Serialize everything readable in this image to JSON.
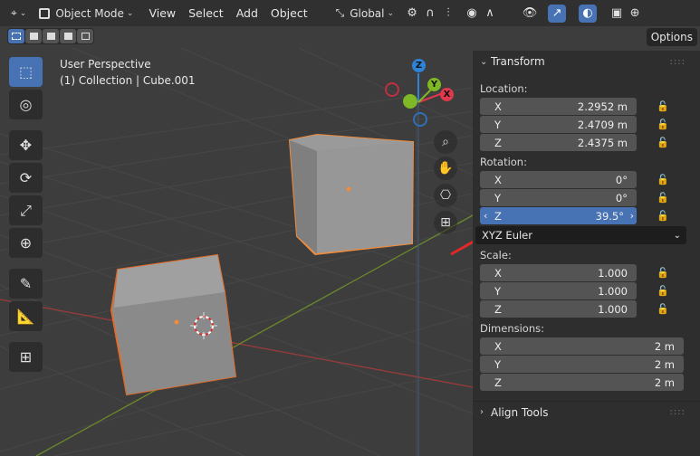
{
  "header": {
    "mode_label": "Object Mode",
    "menus": [
      "View",
      "Select",
      "Add",
      "Object"
    ],
    "orientation_label": "Global"
  },
  "options_label": "Options",
  "overlay": {
    "line1": "User Perspective",
    "line2": "(1) Collection | Cube.001"
  },
  "gizmo": {
    "z_label": "Z",
    "y_label": "Y",
    "x_label": "X",
    "colors": {
      "x": "#e0384c",
      "y": "#7fb827",
      "z": "#2f83d6"
    }
  },
  "panel": {
    "transform_title": "Transform",
    "location_label": "Location:",
    "location": [
      {
        "axis": "X",
        "value": "2.2952 m"
      },
      {
        "axis": "Y",
        "value": "2.4709 m"
      },
      {
        "axis": "Z",
        "value": "2.4375 m"
      }
    ],
    "rotation_label": "Rotation:",
    "rotation": [
      {
        "axis": "X",
        "value": "0°"
      },
      {
        "axis": "Y",
        "value": "0°"
      },
      {
        "axis": "Z",
        "value": "39.5°"
      }
    ],
    "rotation_mode": "XYZ Euler",
    "scale_label": "Scale:",
    "scale": [
      {
        "axis": "X",
        "value": "1.000"
      },
      {
        "axis": "Y",
        "value": "1.000"
      },
      {
        "axis": "Z",
        "value": "1.000"
      }
    ],
    "dimensions_label": "Dimensions:",
    "dimensions": [
      {
        "axis": "X",
        "value": "2 m"
      },
      {
        "axis": "Y",
        "value": "2 m"
      },
      {
        "axis": "Z",
        "value": "2 m"
      }
    ],
    "align_title": "Align Tools"
  },
  "colors": {
    "accent": "#4772b3",
    "selection_outline": "#f08c3c",
    "annotation_arrow": "#e02a2a"
  }
}
